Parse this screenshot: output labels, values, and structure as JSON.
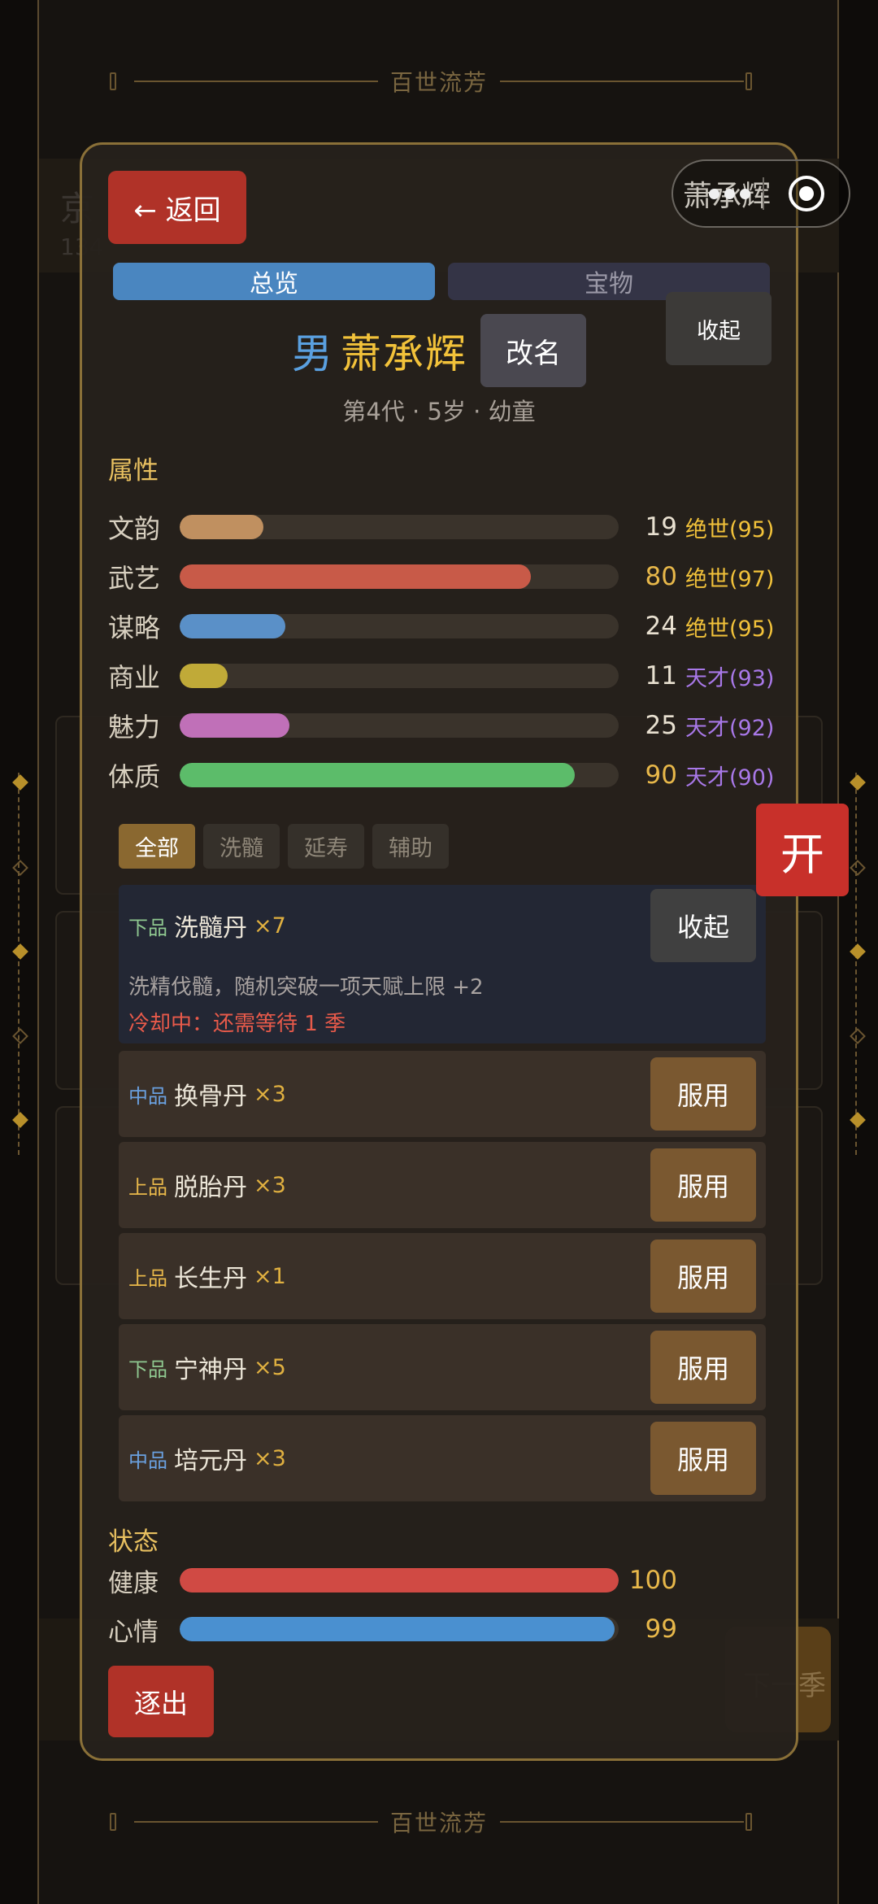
{
  "background": {
    "banner_title": "百世流芳",
    "header_title": "京",
    "header_line": "134",
    "next_button": "下一季"
  },
  "wechat_capsule": {
    "label": "萧承辉",
    "menu_icon": "more-dots-icon",
    "close_icon": "target-circle-icon"
  },
  "modal": {
    "back_label": "← 返回",
    "tabs": [
      {
        "label": "总览",
        "active": true
      },
      {
        "label": "宝物",
        "active": false
      }
    ],
    "gender": "男",
    "name": "萧承辉",
    "rename_label": "改名",
    "subinfo": "第4代 · 5岁 · 幼童",
    "attributes_title": "属性",
    "collapse_label": "收起",
    "attributes": [
      {
        "label": "文韵",
        "value": 19,
        "talent": "绝世(95)",
        "talent_color": "#f2c23a",
        "bar_color": "#c09060",
        "value_color": "#e8e0d0"
      },
      {
        "label": "武艺",
        "value": 80,
        "talent": "绝世(97)",
        "talent_color": "#f2c23a",
        "bar_color": "#c85a48",
        "value_color": "#e8b84a"
      },
      {
        "label": "谋略",
        "value": 24,
        "talent": "绝世(95)",
        "talent_color": "#f2c23a",
        "bar_color": "#5a90c8",
        "value_color": "#e8e0d0"
      },
      {
        "label": "商业",
        "value": 11,
        "talent": "天才(93)",
        "talent_color": "#a878e8",
        "bar_color": "#c0aa38",
        "value_color": "#e8e0d0"
      },
      {
        "label": "魅力",
        "value": 25,
        "talent": "天才(92)",
        "talent_color": "#a878e8",
        "bar_color": "#c070b8",
        "value_color": "#e8e0d0"
      },
      {
        "label": "体质",
        "value": 90,
        "talent": "天才(90)",
        "talent_color": "#a878e8",
        "bar_color": "#5cbc6a",
        "value_color": "#e8b84a"
      }
    ],
    "filters": [
      {
        "label": "全部",
        "active": true
      },
      {
        "label": "洗髓",
        "active": false
      },
      {
        "label": "延寿",
        "active": false
      },
      {
        "label": "辅助",
        "active": false
      }
    ],
    "pills": [
      {
        "grade": "下品",
        "grade_color": "#8fc890",
        "name": "洗髓丹",
        "count": "×7",
        "action": "收起",
        "expanded": true,
        "desc": "洗精伐髓，随机突破一项天赋上限 +2",
        "cooldown": "冷却中：还需等待 1 季"
      },
      {
        "grade": "中品",
        "grade_color": "#6aa0e0",
        "name": "换骨丹",
        "count": "×3",
        "action": "服用",
        "expanded": false
      },
      {
        "grade": "上品",
        "grade_color": "#e8b84a",
        "name": "脱胎丹",
        "count": "×3",
        "action": "服用",
        "expanded": false
      },
      {
        "grade": "上品",
        "grade_color": "#e8b84a",
        "name": "长生丹",
        "count": "×1",
        "action": "服用",
        "expanded": false
      },
      {
        "grade": "下品",
        "grade_color": "#8fc890",
        "name": "宁神丹",
        "count": "×5",
        "action": "服用",
        "expanded": false
      },
      {
        "grade": "中品",
        "grade_color": "#6aa0e0",
        "name": "培元丹",
        "count": "×3",
        "action": "服用",
        "expanded": false
      }
    ],
    "status_title": "状态",
    "status": [
      {
        "label": "健康",
        "value": 100,
        "bar_color": "#d04a44"
      },
      {
        "label": "心情",
        "value": 99,
        "bar_color": "#4a90d0"
      }
    ],
    "expel_label": "逐出"
  },
  "open_button_label": "开"
}
